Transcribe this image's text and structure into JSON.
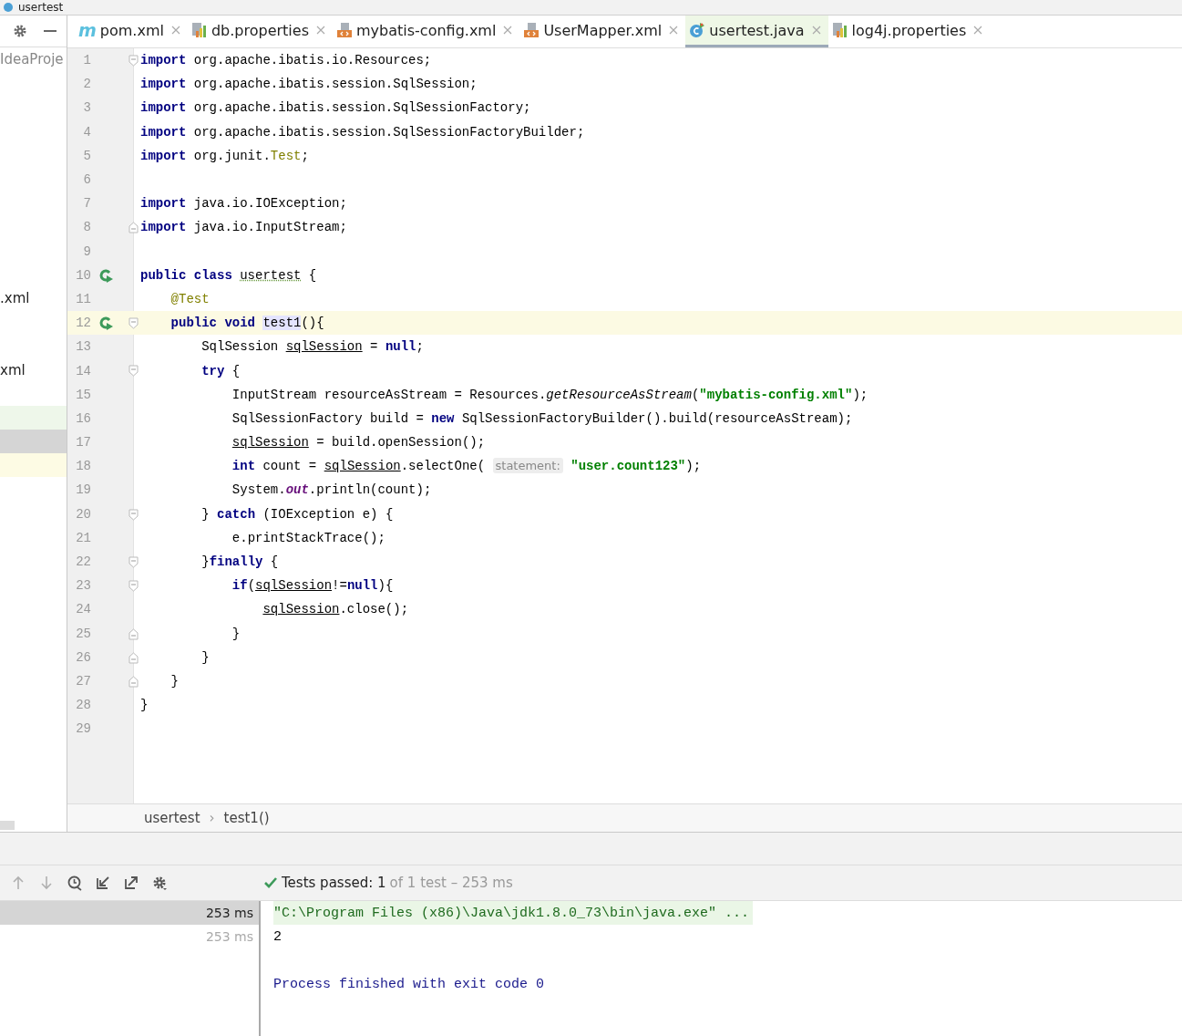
{
  "window": {
    "title": "usertest"
  },
  "sidebar": {
    "items": [
      {
        "kind": "folder",
        "text": "IdeaProje"
      },
      {
        "kind": "file",
        "text": ".xml"
      },
      {
        "kind": "file",
        "text": "xml"
      },
      {
        "kind": "changed"
      },
      {
        "kind": "selected"
      },
      {
        "kind": "current"
      }
    ]
  },
  "tabs": [
    {
      "kind": "maven",
      "glyph": "m",
      "label": "pom.xml",
      "selected": false
    },
    {
      "kind": "properties",
      "label": "db.properties",
      "selected": false
    },
    {
      "kind": "xml",
      "label": "mybatis-config.xml",
      "selected": false
    },
    {
      "kind": "xml",
      "label": "UserMapper.xml",
      "selected": false
    },
    {
      "kind": "class",
      "label": "usertest.java",
      "selected": true
    },
    {
      "kind": "properties",
      "label": "log4j.properties",
      "selected": false
    }
  ],
  "editor": {
    "lines": [
      {
        "number": "1",
        "kind": "fold-start",
        "run": false,
        "current": false,
        "tokens": [
          {
            "kind": "keyword",
            "text": "import "
          },
          {
            "kind": "plain",
            "text": "org.apache.ibatis.io.Resources;"
          }
        ]
      },
      {
        "number": "2",
        "kind": "plain",
        "run": false,
        "current": false,
        "tokens": [
          {
            "kind": "keyword",
            "text": "import "
          },
          {
            "kind": "plain",
            "text": "org.apache.ibatis.session.SqlSession;"
          }
        ]
      },
      {
        "number": "3",
        "kind": "plain",
        "run": false,
        "current": false,
        "tokens": [
          {
            "kind": "keyword",
            "text": "import "
          },
          {
            "kind": "plain",
            "text": "org.apache.ibatis.session.SqlSessionFactory;"
          }
        ]
      },
      {
        "number": "4",
        "kind": "plain",
        "run": false,
        "current": false,
        "tokens": [
          {
            "kind": "keyword",
            "text": "import "
          },
          {
            "kind": "plain",
            "text": "org.apache.ibatis.session.SqlSessionFactoryBuilder;"
          }
        ]
      },
      {
        "number": "5",
        "kind": "plain",
        "run": false,
        "current": false,
        "tokens": [
          {
            "kind": "keyword",
            "text": "import "
          },
          {
            "kind": "plain",
            "text": "org.junit."
          },
          {
            "kind": "annotation",
            "text": "Test"
          },
          {
            "kind": "plain",
            "text": ";"
          }
        ]
      },
      {
        "number": "6",
        "kind": "plain",
        "run": false,
        "current": false
      },
      {
        "number": "7",
        "kind": "plain",
        "run": false,
        "current": false,
        "tokens": [
          {
            "kind": "keyword",
            "text": "import "
          },
          {
            "kind": "plain",
            "text": "java.io.IOException;"
          }
        ]
      },
      {
        "number": "8",
        "kind": "fold-end",
        "run": false,
        "current": false,
        "tokens": [
          {
            "kind": "keyword",
            "text": "import "
          },
          {
            "kind": "plain",
            "text": "java.io.InputStream;"
          }
        ]
      },
      {
        "number": "9",
        "kind": "plain",
        "run": false,
        "current": false
      },
      {
        "number": "10",
        "kind": "plain",
        "run": true,
        "current": false,
        "tokens": [
          {
            "kind": "keyword",
            "text": "public class "
          },
          {
            "kind": "typo",
            "text": "usertest"
          },
          {
            "kind": "plain",
            "text": " {"
          }
        ]
      },
      {
        "number": "11",
        "kind": "plain",
        "run": false,
        "current": false,
        "tokens": [
          {
            "kind": "annotation",
            "text": "    @Test"
          }
        ]
      },
      {
        "number": "12",
        "kind": "fold-start",
        "run": true,
        "current": true,
        "tokens": [
          {
            "kind": "keyword",
            "text": "    public void "
          },
          {
            "kind": "highlight",
            "text": "test1"
          },
          {
            "kind": "plain",
            "text": "(){"
          }
        ]
      },
      {
        "number": "13",
        "kind": "plain",
        "run": false,
        "current": false,
        "tokens": [
          {
            "kind": "plain",
            "text": "        SqlSession "
          },
          {
            "kind": "underline",
            "text": "sqlSession"
          },
          {
            "kind": "plain",
            "text": " = "
          },
          {
            "kind": "keyword",
            "text": "null"
          },
          {
            "kind": "plain",
            "text": ";"
          }
        ]
      },
      {
        "number": "14",
        "kind": "fold-start",
        "run": false,
        "current": false,
        "tokens": [
          {
            "kind": "keyword",
            "text": "        try"
          },
          {
            "kind": "plain",
            "text": " {"
          }
        ]
      },
      {
        "number": "15",
        "kind": "plain",
        "run": false,
        "current": false,
        "tokens": [
          {
            "kind": "plain",
            "text": "            InputStream resourceAsStream = Resources."
          },
          {
            "kind": "italic",
            "text": "getResourceAsStream"
          },
          {
            "kind": "plain",
            "text": "("
          },
          {
            "kind": "string",
            "text": "\"mybatis-config.xml\""
          },
          {
            "kind": "plain",
            "text": ");"
          }
        ]
      },
      {
        "number": "16",
        "kind": "plain",
        "run": false,
        "current": false,
        "tokens": [
          {
            "kind": "plain",
            "text": "            SqlSessionFactory build = "
          },
          {
            "kind": "keyword",
            "text": "new"
          },
          {
            "kind": "plain",
            "text": " SqlSessionFactoryBuilder().build(resourceAsStream);"
          }
        ]
      },
      {
        "number": "17",
        "kind": "plain",
        "run": false,
        "current": false,
        "tokens": [
          {
            "kind": "underline",
            "text": "            sqlSession"
          },
          {
            "kind": "plain",
            "text": " = build.openSession();"
          }
        ]
      },
      {
        "number": "18",
        "kind": "plain",
        "run": false,
        "current": false,
        "tokens": [
          {
            "kind": "keyword",
            "text": "            int"
          },
          {
            "kind": "plain",
            "text": " count = "
          },
          {
            "kind": "underline",
            "text": "sqlSession"
          },
          {
            "kind": "plain",
            "text": ".selectOne( "
          },
          {
            "kind": "hint",
            "text": "statement:"
          },
          {
            "kind": "string",
            "text": " \"user.count123\""
          },
          {
            "kind": "plain",
            "text": ");"
          }
        ]
      },
      {
        "number": "19",
        "kind": "plain",
        "run": false,
        "current": false,
        "tokens": [
          {
            "kind": "plain",
            "text": "            System."
          },
          {
            "kind": "field",
            "text": "out"
          },
          {
            "kind": "plain",
            "text": ".println(count);"
          }
        ]
      },
      {
        "number": "20",
        "kind": "fold-start",
        "run": false,
        "current": false,
        "tokens": [
          {
            "kind": "plain",
            "text": "        } "
          },
          {
            "kind": "keyword",
            "text": "catch"
          },
          {
            "kind": "plain",
            "text": " (IOException e) {"
          }
        ]
      },
      {
        "number": "21",
        "kind": "plain",
        "run": false,
        "current": false,
        "tokens": [
          {
            "kind": "plain",
            "text": "            e.printStackTrace();"
          }
        ]
      },
      {
        "number": "22",
        "kind": "fold-start",
        "run": false,
        "current": false,
        "tokens": [
          {
            "kind": "plain",
            "text": "        }"
          },
          {
            "kind": "keyword",
            "text": "finally"
          },
          {
            "kind": "plain",
            "text": " {"
          }
        ]
      },
      {
        "number": "23",
        "kind": "fold-start",
        "run": false,
        "current": false,
        "tokens": [
          {
            "kind": "keyword",
            "text": "            if"
          },
          {
            "kind": "plain",
            "text": "("
          },
          {
            "kind": "underline",
            "text": "sqlSession"
          },
          {
            "kind": "plain",
            "text": "!="
          },
          {
            "kind": "keyword",
            "text": "null"
          },
          {
            "kind": "plain",
            "text": "){"
          }
        ]
      },
      {
        "number": "24",
        "kind": "plain",
        "run": false,
        "current": false,
        "tokens": [
          {
            "kind": "underline",
            "text": "                sqlSession"
          },
          {
            "kind": "plain",
            "text": ".close();"
          }
        ]
      },
      {
        "number": "25",
        "kind": "fold-end",
        "run": false,
        "current": false,
        "tokens": [
          {
            "kind": "plain",
            "text": "            }"
          }
        ]
      },
      {
        "number": "26",
        "kind": "fold-end",
        "run": false,
        "current": false,
        "tokens": [
          {
            "kind": "plain",
            "text": "        }"
          }
        ]
      },
      {
        "number": "27",
        "kind": "fold-end",
        "run": false,
        "current": false,
        "tokens": [
          {
            "kind": "plain",
            "text": "    }"
          }
        ]
      },
      {
        "number": "28",
        "kind": "plain",
        "run": false,
        "current": false,
        "tokens": [
          {
            "kind": "plain",
            "text": "}"
          }
        ]
      },
      {
        "number": "29",
        "kind": "plain",
        "run": false,
        "current": false
      }
    ]
  },
  "breadcrumb": [
    "usertest",
    "test1()"
  ],
  "separator": "›",
  "run_panel": {
    "toolbar": [
      {
        "kind": "up",
        "disabled": true
      },
      {
        "kind": "down",
        "disabled": true
      },
      {
        "kind": "history",
        "disabled": false
      },
      {
        "kind": "import",
        "disabled": false
      },
      {
        "kind": "export",
        "disabled": false
      },
      {
        "kind": "settings",
        "disabled": false
      }
    ],
    "status": {
      "passed": true,
      "label": "Tests passed: 1",
      "detail": "of 1 test – 253 ms"
    },
    "tests": [
      {
        "time": "253 ms",
        "selected": true
      },
      {
        "time": "253 ms",
        "selected": false
      }
    ],
    "console": [
      {
        "kind": "command",
        "text": "\"C:\\Program Files (x86)\\Java\\jdk1.8.0_73\\bin\\java.exe\" ..."
      },
      {
        "kind": "output",
        "text": "2"
      },
      {
        "kind": "system",
        "text": "Process finished with exit code 0"
      }
    ]
  }
}
